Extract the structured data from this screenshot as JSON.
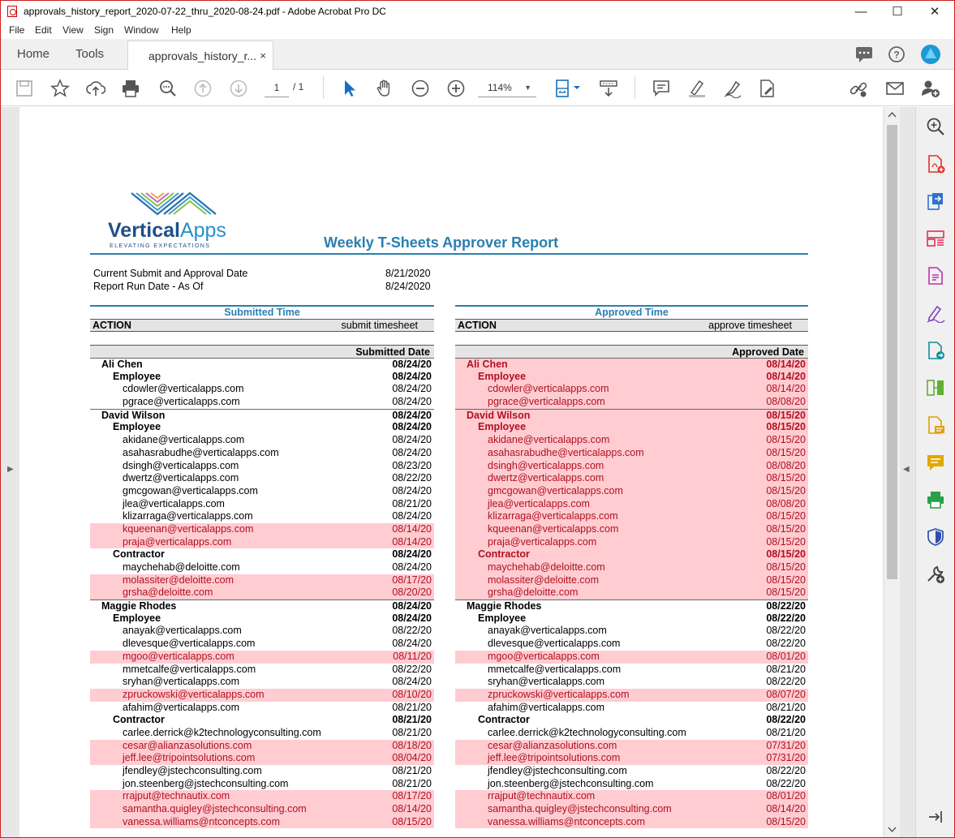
{
  "window": {
    "title": "approvals_history_report_2020-07-22_thru_2020-08-24.pdf - Adobe Acrobat Pro DC",
    "minimize": "—",
    "maximize": "☐",
    "close": "✕"
  },
  "menu": [
    "File",
    "Edit",
    "View",
    "Sign",
    "Window",
    "Help"
  ],
  "tabs": {
    "home": "Home",
    "tools": "Tools",
    "document": "approvals_history_r...",
    "close": "×"
  },
  "toolbar": {
    "page_current": "1",
    "page_total": "/  1",
    "zoom": "114%",
    "icons": [
      "save-icon",
      "bookmark-star-icon",
      "upload-cloud-icon",
      "print-icon",
      "find-zoom-icon",
      "prev-page-icon",
      "next-page-icon",
      "select-cursor-icon",
      "hand-icon",
      "zoom-out-icon",
      "zoom-in-icon",
      "fit-page-icon",
      "scroll-mode-icon",
      "comment-icon",
      "highlight-pen-icon",
      "sign-icon",
      "fill-sign-icon",
      "share-link-icon",
      "email-icon",
      "add-user-icon",
      "chat-icon",
      "help-icon",
      "account-icon"
    ]
  },
  "right_panel_icons": [
    "search-zoom-icon",
    "create-pdf-icon",
    "export-pdf-icon",
    "organize-pages-icon",
    "edit-pdf-icon",
    "fill-sign-icon",
    "send-review-icon",
    "compare-icon",
    "comment-icon",
    "sticky-note-icon",
    "print-production-icon",
    "protect-shield-icon",
    "more-tools-icon",
    "expand-panel-icon"
  ],
  "report": {
    "logo_text": "VerticalApps",
    "logo_tagline": "ELEVATING EXPECTATIONS",
    "title": "Weekly T-Sheets Approver Report",
    "meta": [
      {
        "label": "Current Submit and Approval Date",
        "value": "8/21/2020"
      },
      {
        "label": "Report Run Date - As Of",
        "value": "8/24/2020"
      }
    ],
    "submitted": {
      "section_title": "Submitted Time",
      "action_label": "ACTION",
      "action_value": "submit timesheet",
      "date_header": "Submitted Date"
    },
    "approved": {
      "section_title": "Approved Time",
      "action_label": "ACTION",
      "action_value": "approve timesheet",
      "date_header": "Approved Date"
    },
    "submitted_rows": [
      {
        "level": 1,
        "name": "Ali Chen",
        "date": "08/24/20",
        "red": false
      },
      {
        "level": 2,
        "name": "Employee",
        "date": "08/24/20",
        "red": false
      },
      {
        "level": 3,
        "name": "cdowler@verticalapps.com",
        "date": "08/24/20",
        "red": false
      },
      {
        "level": 3,
        "name": "pgrace@verticalapps.com",
        "date": "08/24/20",
        "red": false
      },
      {
        "level": 1,
        "name": "David Wilson",
        "date": "08/24/20",
        "red": false
      },
      {
        "level": 2,
        "name": "Employee",
        "date": "08/24/20",
        "red": false
      },
      {
        "level": 3,
        "name": "akidane@verticalapps.com",
        "date": "08/24/20",
        "red": false
      },
      {
        "level": 3,
        "name": "asahasrabudhe@verticalapps.com",
        "date": "08/24/20",
        "red": false
      },
      {
        "level": 3,
        "name": "dsingh@verticalapps.com",
        "date": "08/23/20",
        "red": false
      },
      {
        "level": 3,
        "name": "dwertz@verticalapps.com",
        "date": "08/22/20",
        "red": false
      },
      {
        "level": 3,
        "name": "gmcgowan@verticalapps.com",
        "date": "08/24/20",
        "red": false
      },
      {
        "level": 3,
        "name": "jlea@verticalapps.com",
        "date": "08/21/20",
        "red": false
      },
      {
        "level": 3,
        "name": "klizarraga@verticalapps.com",
        "date": "08/24/20",
        "red": false
      },
      {
        "level": 3,
        "name": "kqueenan@verticalapps.com",
        "date": "08/14/20",
        "red": true
      },
      {
        "level": 3,
        "name": "praja@verticalapps.com",
        "date": "08/14/20",
        "red": true
      },
      {
        "level": 2,
        "name": "Contractor",
        "date": "08/24/20",
        "red": false
      },
      {
        "level": 3,
        "name": "maychehab@deloitte.com",
        "date": "08/24/20",
        "red": false
      },
      {
        "level": 3,
        "name": "molassiter@deloitte.com",
        "date": "08/17/20",
        "red": true
      },
      {
        "level": 3,
        "name": "grsha@deloitte.com",
        "date": "08/20/20",
        "red": true
      },
      {
        "level": 1,
        "name": "Maggie Rhodes",
        "date": "08/24/20",
        "red": false
      },
      {
        "level": 2,
        "name": "Employee",
        "date": "08/24/20",
        "red": false
      },
      {
        "level": 3,
        "name": "anayak@verticalapps.com",
        "date": "08/22/20",
        "red": false
      },
      {
        "level": 3,
        "name": "dlevesque@verticalapps.com",
        "date": "08/24/20",
        "red": false
      },
      {
        "level": 3,
        "name": "mgoo@verticalapps.com",
        "date": "08/11/20",
        "red": true
      },
      {
        "level": 3,
        "name": "mmetcalfe@verticalapps.com",
        "date": "08/22/20",
        "red": false
      },
      {
        "level": 3,
        "name": "sryhan@verticalapps.com",
        "date": "08/24/20",
        "red": false
      },
      {
        "level": 3,
        "name": "zpruckowski@verticalapps.com",
        "date": "08/10/20",
        "red": true
      },
      {
        "level": 3,
        "name": "afahim@verticalapps.com",
        "date": "08/21/20",
        "red": false
      },
      {
        "level": 2,
        "name": "Contractor",
        "date": "08/21/20",
        "red": false
      },
      {
        "level": 3,
        "name": "carlee.derrick@k2technologyconsulting.com",
        "date": "08/21/20",
        "red": false
      },
      {
        "level": 3,
        "name": "cesar@alianzasolutions.com",
        "date": "08/18/20",
        "red": true
      },
      {
        "level": 3,
        "name": "jeff.lee@tripointsolutions.com",
        "date": "08/04/20",
        "red": true
      },
      {
        "level": 3,
        "name": "jfendley@jstechconsulting.com",
        "date": "08/21/20",
        "red": false
      },
      {
        "level": 3,
        "name": "jon.steenberg@jstechconsulting.com",
        "date": "08/21/20",
        "red": false
      },
      {
        "level": 3,
        "name": "rrajput@technautix.com",
        "date": "08/17/20",
        "red": true
      },
      {
        "level": 3,
        "name": "samantha.quigley@jstechconsulting.com",
        "date": "08/14/20",
        "red": true
      },
      {
        "level": 3,
        "name": "vanessa.williams@ntconcepts.com",
        "date": "08/15/20",
        "red": true
      }
    ],
    "approved_rows": [
      {
        "level": 1,
        "name": "Ali Chen",
        "date": "08/14/20",
        "red": true
      },
      {
        "level": 2,
        "name": "Employee",
        "date": "08/14/20",
        "red": true
      },
      {
        "level": 3,
        "name": "cdowler@verticalapps.com",
        "date": "08/14/20",
        "red": true
      },
      {
        "level": 3,
        "name": "pgrace@verticalapps.com",
        "date": "08/08/20",
        "red": true
      },
      {
        "level": 1,
        "name": "David Wilson",
        "date": "08/15/20",
        "red": true
      },
      {
        "level": 2,
        "name": "Employee",
        "date": "08/15/20",
        "red": true
      },
      {
        "level": 3,
        "name": "akidane@verticalapps.com",
        "date": "08/15/20",
        "red": true
      },
      {
        "level": 3,
        "name": "asahasrabudhe@verticalapps.com",
        "date": "08/15/20",
        "red": true
      },
      {
        "level": 3,
        "name": "dsingh@verticalapps.com",
        "date": "08/08/20",
        "red": true
      },
      {
        "level": 3,
        "name": "dwertz@verticalapps.com",
        "date": "08/15/20",
        "red": true
      },
      {
        "level": 3,
        "name": "gmcgowan@verticalapps.com",
        "date": "08/15/20",
        "red": true
      },
      {
        "level": 3,
        "name": "jlea@verticalapps.com",
        "date": "08/08/20",
        "red": true
      },
      {
        "level": 3,
        "name": "klizarraga@verticalapps.com",
        "date": "08/15/20",
        "red": true
      },
      {
        "level": 3,
        "name": "kqueenan@verticalapps.com",
        "date": "08/15/20",
        "red": true
      },
      {
        "level": 3,
        "name": "praja@verticalapps.com",
        "date": "08/15/20",
        "red": true
      },
      {
        "level": 2,
        "name": "Contractor",
        "date": "08/15/20",
        "red": true
      },
      {
        "level": 3,
        "name": "maychehab@deloitte.com",
        "date": "08/15/20",
        "red": true
      },
      {
        "level": 3,
        "name": "molassiter@deloitte.com",
        "date": "08/15/20",
        "red": true
      },
      {
        "level": 3,
        "name": "grsha@deloitte.com",
        "date": "08/15/20",
        "red": true
      },
      {
        "level": 1,
        "name": "Maggie Rhodes",
        "date": "08/22/20",
        "red": false
      },
      {
        "level": 2,
        "name": "Employee",
        "date": "08/22/20",
        "red": false
      },
      {
        "level": 3,
        "name": "anayak@verticalapps.com",
        "date": "08/22/20",
        "red": false
      },
      {
        "level": 3,
        "name": "dlevesque@verticalapps.com",
        "date": "08/22/20",
        "red": false
      },
      {
        "level": 3,
        "name": "mgoo@verticalapps.com",
        "date": "08/01/20",
        "red": true
      },
      {
        "level": 3,
        "name": "mmetcalfe@verticalapps.com",
        "date": "08/21/20",
        "red": false
      },
      {
        "level": 3,
        "name": "sryhan@verticalapps.com",
        "date": "08/22/20",
        "red": false
      },
      {
        "level": 3,
        "name": "zpruckowski@verticalapps.com",
        "date": "08/07/20",
        "red": true
      },
      {
        "level": 3,
        "name": "afahim@verticalapps.com",
        "date": "08/21/20",
        "red": false
      },
      {
        "level": 2,
        "name": "Contractor",
        "date": "08/22/20",
        "red": false
      },
      {
        "level": 3,
        "name": "carlee.derrick@k2technologyconsulting.com",
        "date": "08/21/20",
        "red": false
      },
      {
        "level": 3,
        "name": "cesar@alianzasolutions.com",
        "date": "07/31/20",
        "red": true
      },
      {
        "level": 3,
        "name": "jeff.lee@tripointsolutions.com",
        "date": "07/31/20",
        "red": true
      },
      {
        "level": 3,
        "name": "jfendley@jstechconsulting.com",
        "date": "08/22/20",
        "red": false
      },
      {
        "level": 3,
        "name": "jon.steenberg@jstechconsulting.com",
        "date": "08/22/20",
        "red": false
      },
      {
        "level": 3,
        "name": "rrajput@technautix.com",
        "date": "08/01/20",
        "red": true
      },
      {
        "level": 3,
        "name": "samantha.quigley@jstechconsulting.com",
        "date": "08/14/20",
        "red": true
      },
      {
        "level": 3,
        "name": "vanessa.williams@ntconcepts.com",
        "date": "08/15/20",
        "red": true
      }
    ]
  },
  "colors": {
    "accent": "#2a7fb0",
    "highlight_bg": "#ffccd1",
    "highlight_text": "#b01020",
    "window_border": "#d02020"
  }
}
